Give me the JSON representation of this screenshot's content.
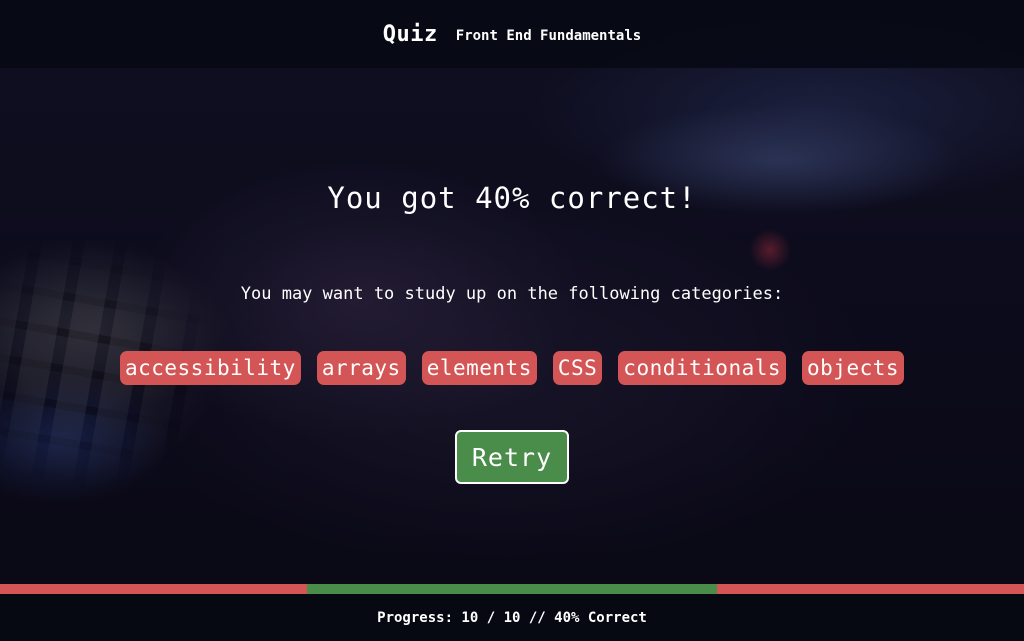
{
  "header": {
    "brand": "Quiz",
    "subtitle": "Front End Fundamentals"
  },
  "result": {
    "score_text": "You got 40% correct!",
    "study_text": "You may want to study up on the following categories:"
  },
  "categories": [
    "accessibility",
    "arrays",
    "elements",
    "CSS",
    "conditionals",
    "objects"
  ],
  "retry_label": "Retry",
  "progress": {
    "answered": 10,
    "total": 10,
    "percent_correct": 40,
    "footer_text": "Progress: 10 / 10 // 40% Correct",
    "segments": [
      {
        "status": "incorrect",
        "count": 3
      },
      {
        "status": "correct",
        "count": 4
      },
      {
        "status": "incorrect",
        "count": 3
      }
    ]
  },
  "colors": {
    "incorrect": "#d45555",
    "correct": "#4a8c4a",
    "retry_bg": "#4a8c4a",
    "chip_bg": "#d45555"
  }
}
